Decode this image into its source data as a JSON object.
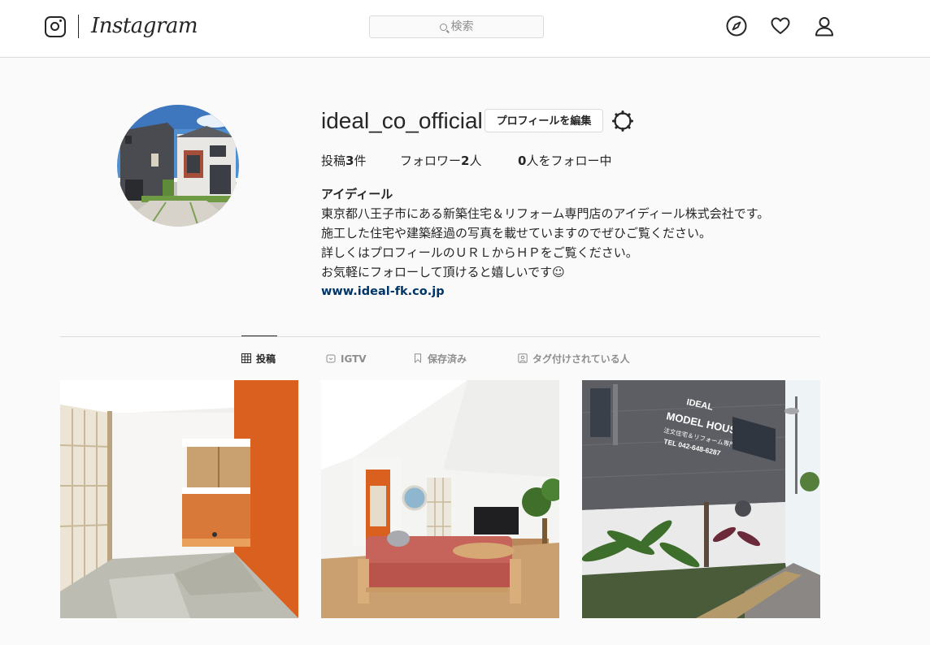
{
  "nav": {
    "brand": "Instagram",
    "search_placeholder": "検索",
    "icons": [
      "instagram-logo-icon",
      "search-icon",
      "explore-compass-icon",
      "activity-heart-icon",
      "profile-person-icon"
    ]
  },
  "profile": {
    "username": "ideal_co_official",
    "edit_button": "プロフィールを編集",
    "settings_icon": "gear-icon",
    "stats": {
      "posts_label": "投稿",
      "posts_count": "3",
      "posts_unit": "件",
      "followers_label": "フォロワー",
      "followers_count": "2",
      "followers_unit": "人",
      "following_count": "0",
      "following_label": "人をフォロー中"
    },
    "full_name": "アイディール",
    "bio": [
      "東京都八王子市にある新築住宅＆リフォーム専門店のアイディール株式会社です。",
      "施工した住宅や建築経過の写真を載せていますのでぜひご覧ください。",
      "詳しくはプロフィールのＵＲＬからＨＰをご覧ください。",
      "お気軽にフォローして頂けると嬉しいです☺"
    ],
    "website": "www.ideal-fk.co.jp"
  },
  "tabs": [
    {
      "label": "投稿",
      "icon": "grid-icon",
      "active": true
    },
    {
      "label": "IGTV",
      "icon": "igtv-icon",
      "active": false
    },
    {
      "label": "保存済み",
      "icon": "bookmark-icon",
      "active": false
    },
    {
      "label": "タグ付けされている人",
      "icon": "tagged-person-icon",
      "active": false
    }
  ],
  "model_house_sign": {
    "brand": "IDEAL",
    "title": "MODEL HOUSE",
    "subtitle": "注文住宅＆リフォーム専門店",
    "phone": "TEL 042-648-6287"
  },
  "colors": {
    "link": "#003569",
    "border": "#dbdbdb",
    "text": "#262626",
    "muted": "#8e8e8e",
    "accent_orange": "#d9601f"
  }
}
